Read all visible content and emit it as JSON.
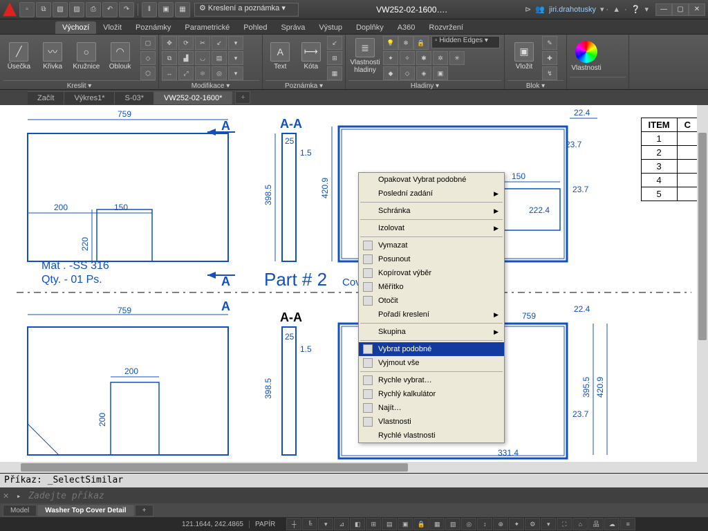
{
  "app": {
    "doc_title": "VW252-02-1600….",
    "user": "jiri.drahotusky",
    "workspace_selector": "Kreslení a poznámka"
  },
  "ribbon_tabs": [
    "Výchozí",
    "Vložit",
    "Poznámky",
    "Parametrické",
    "Pohled",
    "Správa",
    "Výstup",
    "Doplňky",
    "A360",
    "Rozvržení"
  ],
  "ribbon_active_tab": 0,
  "panels": {
    "draw": {
      "title": "Kreslit ▾",
      "btns": [
        "Úsečka",
        "Křivka",
        "Kružnice",
        "Oblouk"
      ]
    },
    "modify": {
      "title": "Modifikace ▾"
    },
    "annot": {
      "title": "Poznámka ▾",
      "btns": [
        "Text",
        "Kóta"
      ]
    },
    "layers": {
      "title": "Hladiny ▾",
      "prop": "Vlastnosti\nhladiny",
      "combo": "Hidden Edges"
    },
    "block": {
      "title": "Blok ▾",
      "btn": "Vložit"
    },
    "props": {
      "title": "Vlastnosti"
    }
  },
  "file_tabs": [
    "Začít",
    "Výkres1*",
    "S-03*",
    "VW252-02-1600*"
  ],
  "file_tab_active": 3,
  "drawing": {
    "top_dim": "759",
    "section_label": "A-A",
    "dim_25": "25",
    "dim_1_5": "1.5",
    "dim_398_5": "398.5",
    "dim_420_9": "420.9",
    "dim_395_5": "395.5",
    "dim_220": "220",
    "dim_200_a": "200",
    "dim_200_b": "200",
    "dim_150_a": "150",
    "dim_150_b": "150",
    "dim_23_7_a": "23.7",
    "dim_23_7_b": "23.7",
    "dim_23_7_c": "23.7",
    "dim_22_4_a": "22.4",
    "dim_22_4_b": "22.4",
    "dim_222_4": "222.4",
    "dim_331_4": "331.4",
    "letter_A": "A",
    "mat": "Mat . -SS 316",
    "qty": "Qty. - 01 Ps.",
    "part2": "Part # 2",
    "cover": "Cove"
  },
  "item_table": {
    "header": "ITEM",
    "col2": "C",
    "rows": [
      "1",
      "2",
      "3",
      "4",
      "5"
    ]
  },
  "context_menu": {
    "items": [
      {
        "label": "Opakovat Vybrat podobné",
        "icon": false,
        "sub": false
      },
      {
        "label": "Poslední zadání",
        "icon": false,
        "sub": true
      },
      {
        "sep": true
      },
      {
        "label": "Schránka",
        "icon": false,
        "sub": true
      },
      {
        "sep": true
      },
      {
        "label": "Izolovat",
        "icon": false,
        "sub": true
      },
      {
        "sep": true
      },
      {
        "label": "Vymazat",
        "icon": true,
        "sub": false
      },
      {
        "label": "Posunout",
        "icon": true,
        "sub": false
      },
      {
        "label": "Kopírovat výběr",
        "icon": true,
        "sub": false
      },
      {
        "label": "Měřítko",
        "icon": true,
        "sub": false
      },
      {
        "label": "Otočit",
        "icon": true,
        "sub": false
      },
      {
        "label": "Pořadí kreslení",
        "icon": false,
        "sub": true
      },
      {
        "sep": true
      },
      {
        "label": "Skupina",
        "icon": false,
        "sub": true
      },
      {
        "sep": true
      },
      {
        "label": "Vybrat podobné",
        "icon": true,
        "sub": false,
        "hl": true
      },
      {
        "label": "Vyjmout vše",
        "icon": true,
        "sub": false
      },
      {
        "sep": true
      },
      {
        "label": "Rychle vybrat…",
        "icon": true,
        "sub": false
      },
      {
        "label": "Rychlý kalkulátor",
        "icon": true,
        "sub": false
      },
      {
        "label": "Najít…",
        "icon": true,
        "sub": false
      },
      {
        "label": "Vlastnosti",
        "icon": true,
        "sub": false
      },
      {
        "label": "Rychlé vlastnosti",
        "icon": false,
        "sub": false
      }
    ]
  },
  "command": {
    "history": "Příkaz: _SelectSimilar",
    "placeholder": "Zadejte příkaz",
    "prompt": "▸_"
  },
  "layout_tabs": [
    "Model",
    "Washer Top Cover Detail"
  ],
  "layout_active": 1,
  "status": {
    "coords": "121.1644, 242.4865",
    "space": "PAPÍR"
  }
}
